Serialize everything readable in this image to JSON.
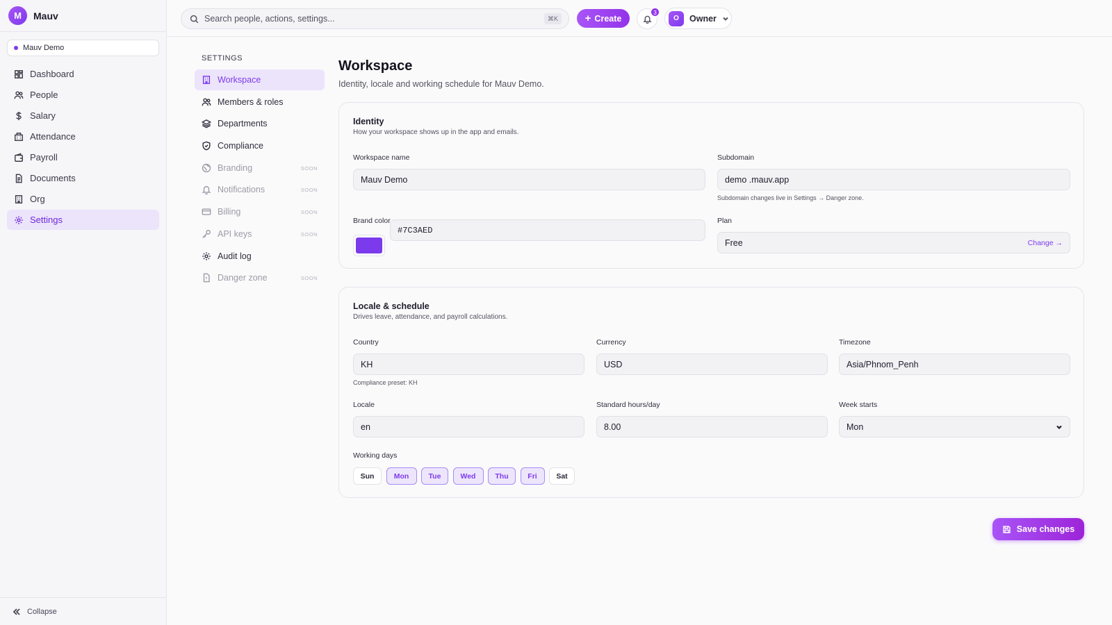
{
  "app": {
    "logo_letter": "M",
    "name": "Mauv"
  },
  "workspace_switcher": {
    "label": "Mauv Demo"
  },
  "sidebar": {
    "items": [
      {
        "label": "Dashboard",
        "icon": "dashboard-icon"
      },
      {
        "label": "People",
        "icon": "people-icon"
      },
      {
        "label": "Salary",
        "icon": "dollar-icon"
      },
      {
        "label": "Attendance",
        "icon": "building-icon"
      },
      {
        "label": "Payroll",
        "icon": "wallet-icon"
      },
      {
        "label": "Documents",
        "icon": "document-icon"
      },
      {
        "label": "Org",
        "icon": "org-icon"
      },
      {
        "label": "Settings",
        "icon": "gear-icon",
        "active": true
      }
    ],
    "collapse_label": "Collapse"
  },
  "topbar": {
    "search_placeholder": "Search people, actions, settings...",
    "search_shortcut": "⌘K",
    "create_label": "Create",
    "notification_count": "3",
    "user_initial": "O",
    "user_role": "Owner"
  },
  "settings_nav": {
    "title": "SETTINGS",
    "items": [
      {
        "label": "Workspace",
        "icon": "building-icon",
        "active": true
      },
      {
        "label": "Members & roles",
        "icon": "users-icon"
      },
      {
        "label": "Departments",
        "icon": "layers-icon"
      },
      {
        "label": "Compliance",
        "icon": "shield-icon"
      },
      {
        "label": "Branding",
        "icon": "palette-icon",
        "soon": "SOON"
      },
      {
        "label": "Notifications",
        "icon": "bell-icon",
        "soon": "SOON"
      },
      {
        "label": "Billing",
        "icon": "card-icon",
        "soon": "SOON"
      },
      {
        "label": "API keys",
        "icon": "key-icon",
        "soon": "SOON"
      },
      {
        "label": "Audit log",
        "icon": "gear-icon"
      },
      {
        "label": "Danger zone",
        "icon": "file-icon",
        "soon": "SOON"
      }
    ]
  },
  "page": {
    "title": "Workspace",
    "subtitle": "Identity, locale and working schedule for Mauv Demo."
  },
  "identity": {
    "title": "Identity",
    "subtitle": "How your workspace shows up in the app and emails.",
    "workspace_name_label": "Workspace name",
    "workspace_name_value": "Mauv Demo",
    "subdomain_label": "Subdomain",
    "subdomain_value": "demo .mauv.app",
    "subdomain_help": "Subdomain changes live in Settings → Danger zone.",
    "brand_color_label": "Brand color",
    "brand_color_value": "#7C3AED",
    "plan_label": "Plan",
    "plan_value": "Free",
    "plan_change": "Change →"
  },
  "locale": {
    "title": "Locale & schedule",
    "subtitle": "Drives leave, attendance, and payroll calculations.",
    "country_label": "Country",
    "country_value": "KH",
    "country_help": "Compliance preset: KH",
    "currency_label": "Currency",
    "currency_value": "USD",
    "timezone_label": "Timezone",
    "timezone_value": "Asia/Phnom_Penh",
    "locale_label": "Locale",
    "locale_value": "en",
    "hours_label": "Standard hours/day",
    "hours_value": "8.00",
    "week_starts_label": "Week starts",
    "week_starts_value": "Mon",
    "working_days_label": "Working days",
    "days": [
      {
        "label": "Sun",
        "on": false
      },
      {
        "label": "Mon",
        "on": true
      },
      {
        "label": "Tue",
        "on": true
      },
      {
        "label": "Wed",
        "on": true
      },
      {
        "label": "Thu",
        "on": true
      },
      {
        "label": "Fri",
        "on": true
      },
      {
        "label": "Sat",
        "on": false
      }
    ]
  },
  "actions": {
    "save_label": "Save changes"
  },
  "colors": {
    "accent": "#7C3AED",
    "accent_light": "#A855F7",
    "active_bg": "#ECE4FB"
  }
}
